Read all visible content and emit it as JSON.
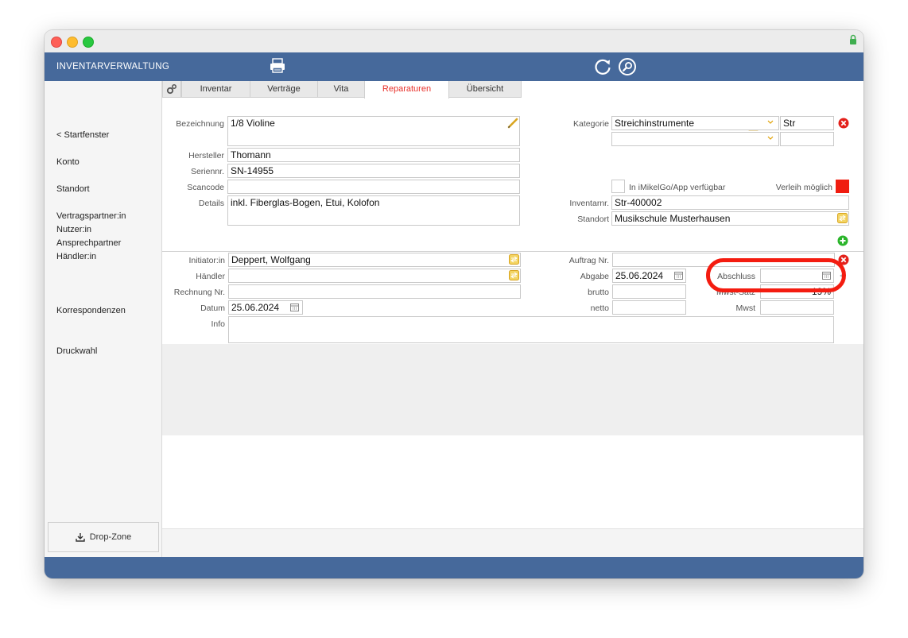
{
  "app": {
    "title": "INVENTARVERWALTUNG"
  },
  "sidebar": {
    "back": "< Startfenster",
    "items": [
      "Konto",
      "Standort",
      "Vertragspartner:in",
      "Nutzer:in",
      "Ansprechpartner",
      "Händler:in",
      "Korrespondenzen",
      "Druckwahl"
    ],
    "dropzone": "Drop-Zone"
  },
  "tabs": [
    "Inventar",
    "Verträge",
    "Vita",
    "Reparaturen",
    "Übersicht"
  ],
  "active_tab": "Reparaturen",
  "item": {
    "bezeichnung_label": "Bezeichnung",
    "bezeichnung": "1/8 Violine",
    "hersteller_label": "Hersteller",
    "hersteller": "Thomann",
    "seriennr_label": "Seriennr.",
    "seriennr": "SN-14955",
    "scancode_label": "Scancode",
    "scancode": "",
    "details_label": "Details",
    "details": "inkl. Fiberglas-Bogen, Etui, Kolofon",
    "kategorie_label": "Kategorie",
    "kategorie": "Streichinstrumente",
    "kategorie_code": "Str",
    "app_label": "In iMikelGo/App verfügbar",
    "verleih_label": "Verleih möglich",
    "inventarnr_label": "Inventarnr.",
    "inventarnr": "Str-400002",
    "standort_label": "Standort",
    "standort": "Musikschule Musterhausen"
  },
  "repair": {
    "initiator_label": "Initiator:in",
    "initiator": "Deppert, Wolfgang",
    "haendler_label": "Händler",
    "haendler": "",
    "rechnung_label": "Rechnung Nr.",
    "rechnung": "",
    "datum_label": "Datum",
    "datum": "25.06.2024",
    "info_label": "Info",
    "info": "",
    "auftrag_label": "Auftrag Nr.",
    "auftrag": "",
    "abgabe_label": "Abgabe",
    "abgabe": "25.06.2024",
    "brutto_label": "brutto",
    "brutto": "",
    "netto_label": "netto",
    "netto": "",
    "abschluss_label": "Abschluss",
    "abschluss": "",
    "mwst_satz_label": "Mwst-Satz",
    "mwst_satz": "19%",
    "mwst_label": "Mwst",
    "mwst": ""
  },
  "colors": {
    "appbar": "#46699b",
    "accent_red": "#e8312a",
    "highlight": "#f41c10",
    "add_green": "#2bb52b"
  }
}
